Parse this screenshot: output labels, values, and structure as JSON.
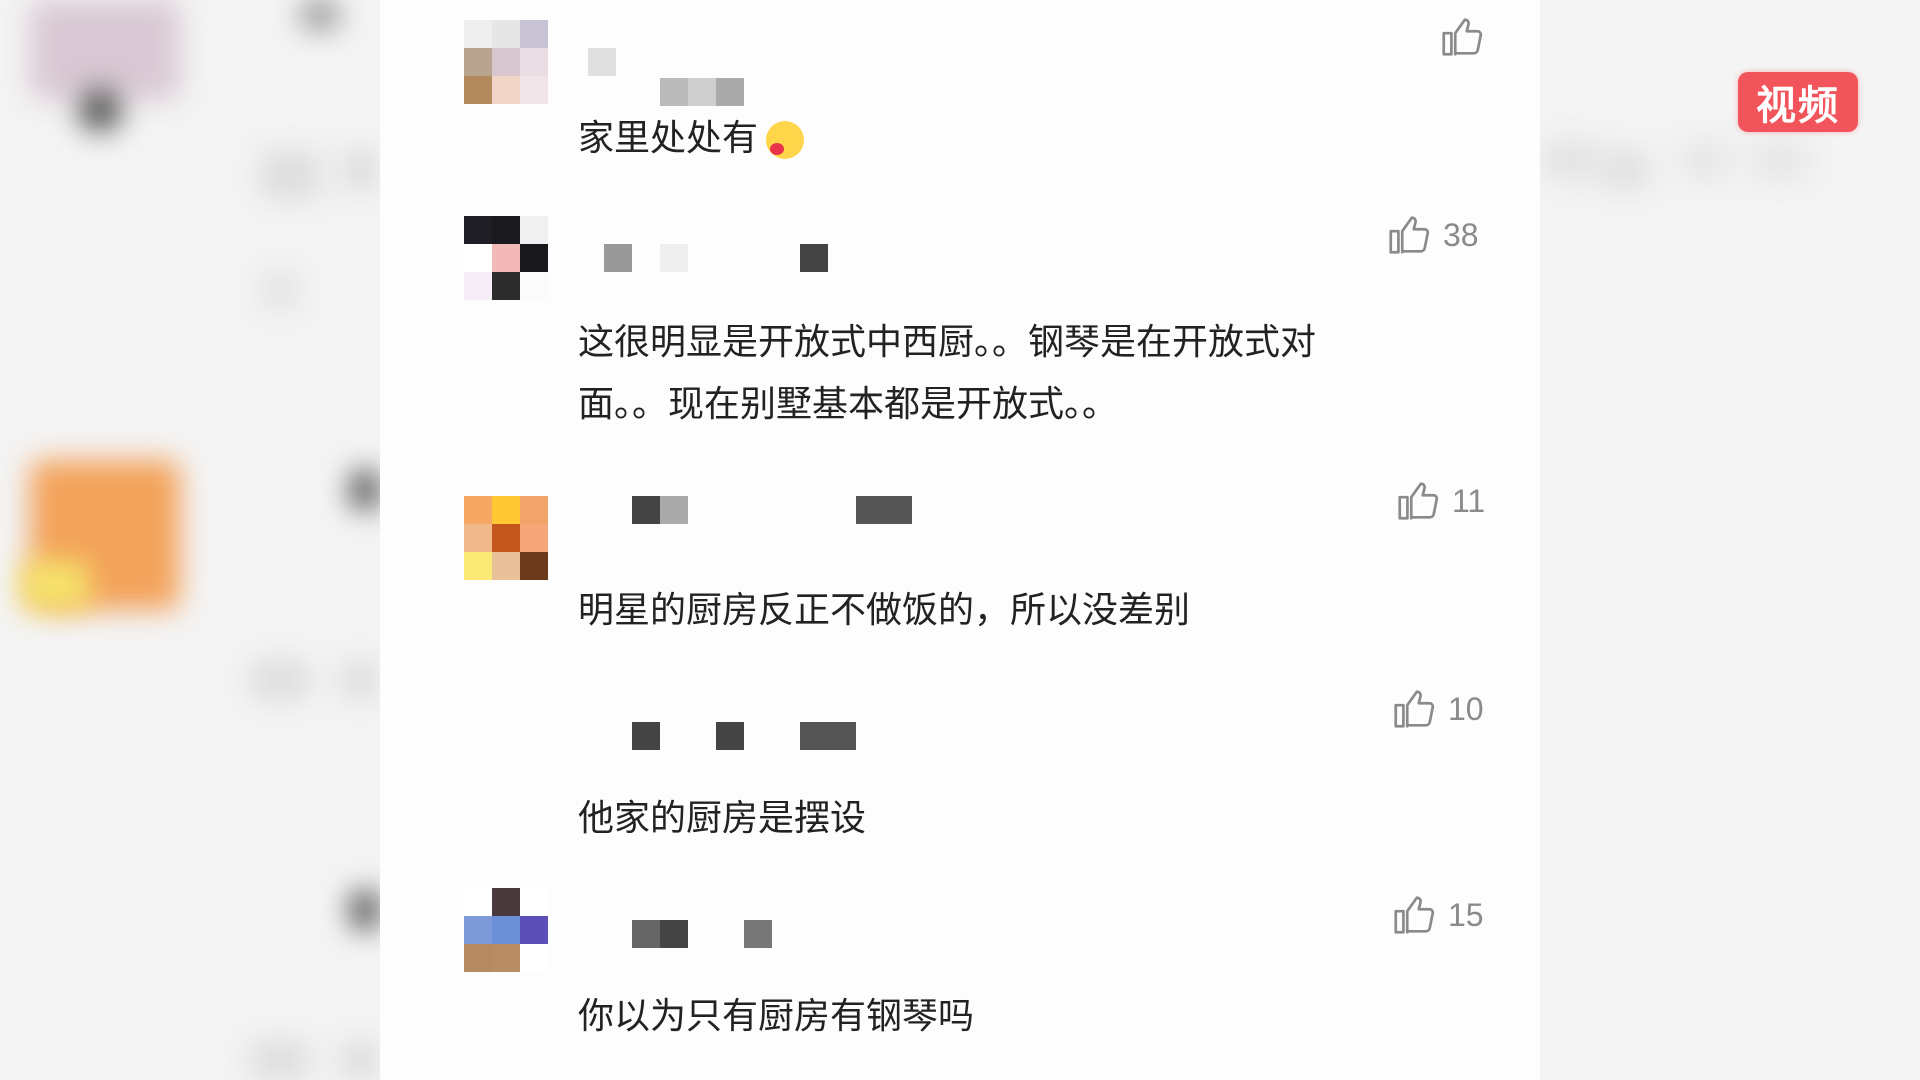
{
  "badge": {
    "label": "视频",
    "color": "#f2545b"
  },
  "comments": [
    {
      "text": "家里处处有",
      "likes": "",
      "emoji": "kiss-emoji"
    },
    {
      "text": "这很明显是开放式中西厨。。钢琴是在开放式对",
      "text2": "面。。现在别墅基本都是开放式。。",
      "likes": "38"
    },
    {
      "text": "明星的厨房反正不做饭的，所以没差别",
      "likes": "11"
    },
    {
      "text": "他家的厨房是摆设",
      "likes": "10"
    },
    {
      "text": "你以为只有厨房有钢琴吗",
      "likes": "15"
    }
  ],
  "icons": {
    "like": "thumbs-up-icon"
  }
}
